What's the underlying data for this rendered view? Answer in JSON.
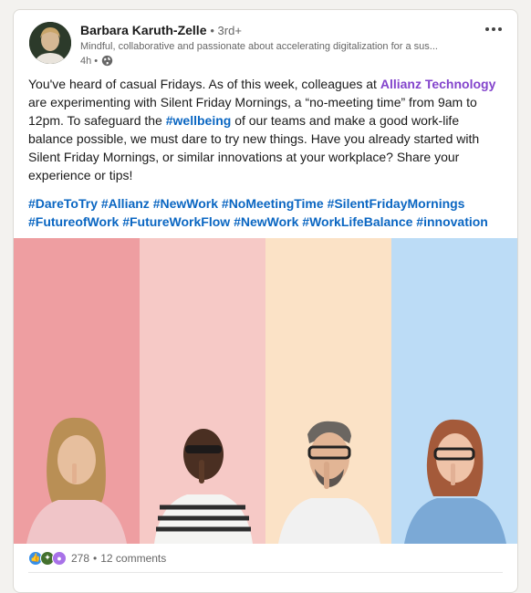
{
  "post": {
    "author": {
      "name": "Barbara Karuth-Zelle",
      "connection": "• 3rd+",
      "headline": "Mindful, collaborative and passionate about accelerating digitalization for a sus...",
      "time": "4h •"
    },
    "body": {
      "part1": "You've heard of casual Fridays. As of this week, colleagues at ",
      "company_mention": "Allianz Technology",
      "part2": " are experimenting with Silent Friday Mornings, a “no-meeting time” from 9am to 12pm. To safeguard the ",
      "inline_hashtag": "#wellbeing",
      "part3": " of our teams and make a good work-life balance possible, we must dare to try new things. Have you already started with Silent Friday Mornings, or similar innovations at your workplace? Share your experience or tips!"
    },
    "hashtags": [
      "#DareToTry",
      "#Allianz",
      "#NewWork",
      "#NoMeetingTime",
      "#SilentFridayMornings",
      "#FutureofWork",
      "#FutureWorkFlow",
      "#NewWork",
      "#WorkLifeBalance",
      "#innovation"
    ],
    "image": {
      "stripe_colors": [
        "#ee9ea1",
        "#f6c9c6",
        "#fbe2c6",
        "#bcdcf6"
      ]
    },
    "social": {
      "reactions": "278",
      "separator": "•",
      "comments": "12 comments"
    }
  },
  "icons": {
    "visibility": "globe-icon",
    "menu": "more-options-icon",
    "reactions": [
      "like-icon",
      "celebrate-icon",
      "insightful-icon"
    ]
  }
}
